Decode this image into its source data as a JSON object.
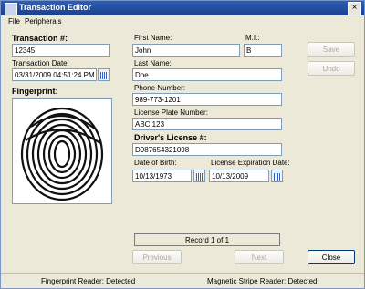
{
  "window": {
    "title": "Transaction Editor",
    "close": "×"
  },
  "menu": {
    "file": "File",
    "peripherals": "Peripherals"
  },
  "transaction": {
    "number_label": "Transaction #:",
    "number": "12345",
    "date_label": "Transaction Date:",
    "date": "03/31/2009 04:51:24 PM"
  },
  "fingerprint": {
    "label": "Fingerprint:"
  },
  "person": {
    "first_name_label": "First Name:",
    "first_name": "John",
    "mi_label": "M.I.:",
    "mi": "B",
    "last_name_label": "Last Name:",
    "last_name": "Doe",
    "phone_label": "Phone Number:",
    "phone": "989-773-1201",
    "plate_label": "License Plate Number:",
    "plate": "ABC 123",
    "dl_label": "Driver's License #:",
    "dl": "D987654321098",
    "dob_label": "Date of Birth:",
    "dob": "10/13/1973",
    "exp_label": "License Expiration Date:",
    "exp": "10/13/2009"
  },
  "buttons": {
    "save": "Save",
    "undo": "Undo",
    "previous": "Previous",
    "next": "Next",
    "close": "Close"
  },
  "record": "Record 1 of 1",
  "status": {
    "fingerprint_reader": "Fingerprint Reader: Detected",
    "magstripe_reader": "Magnetic Stripe Reader: Detected"
  }
}
